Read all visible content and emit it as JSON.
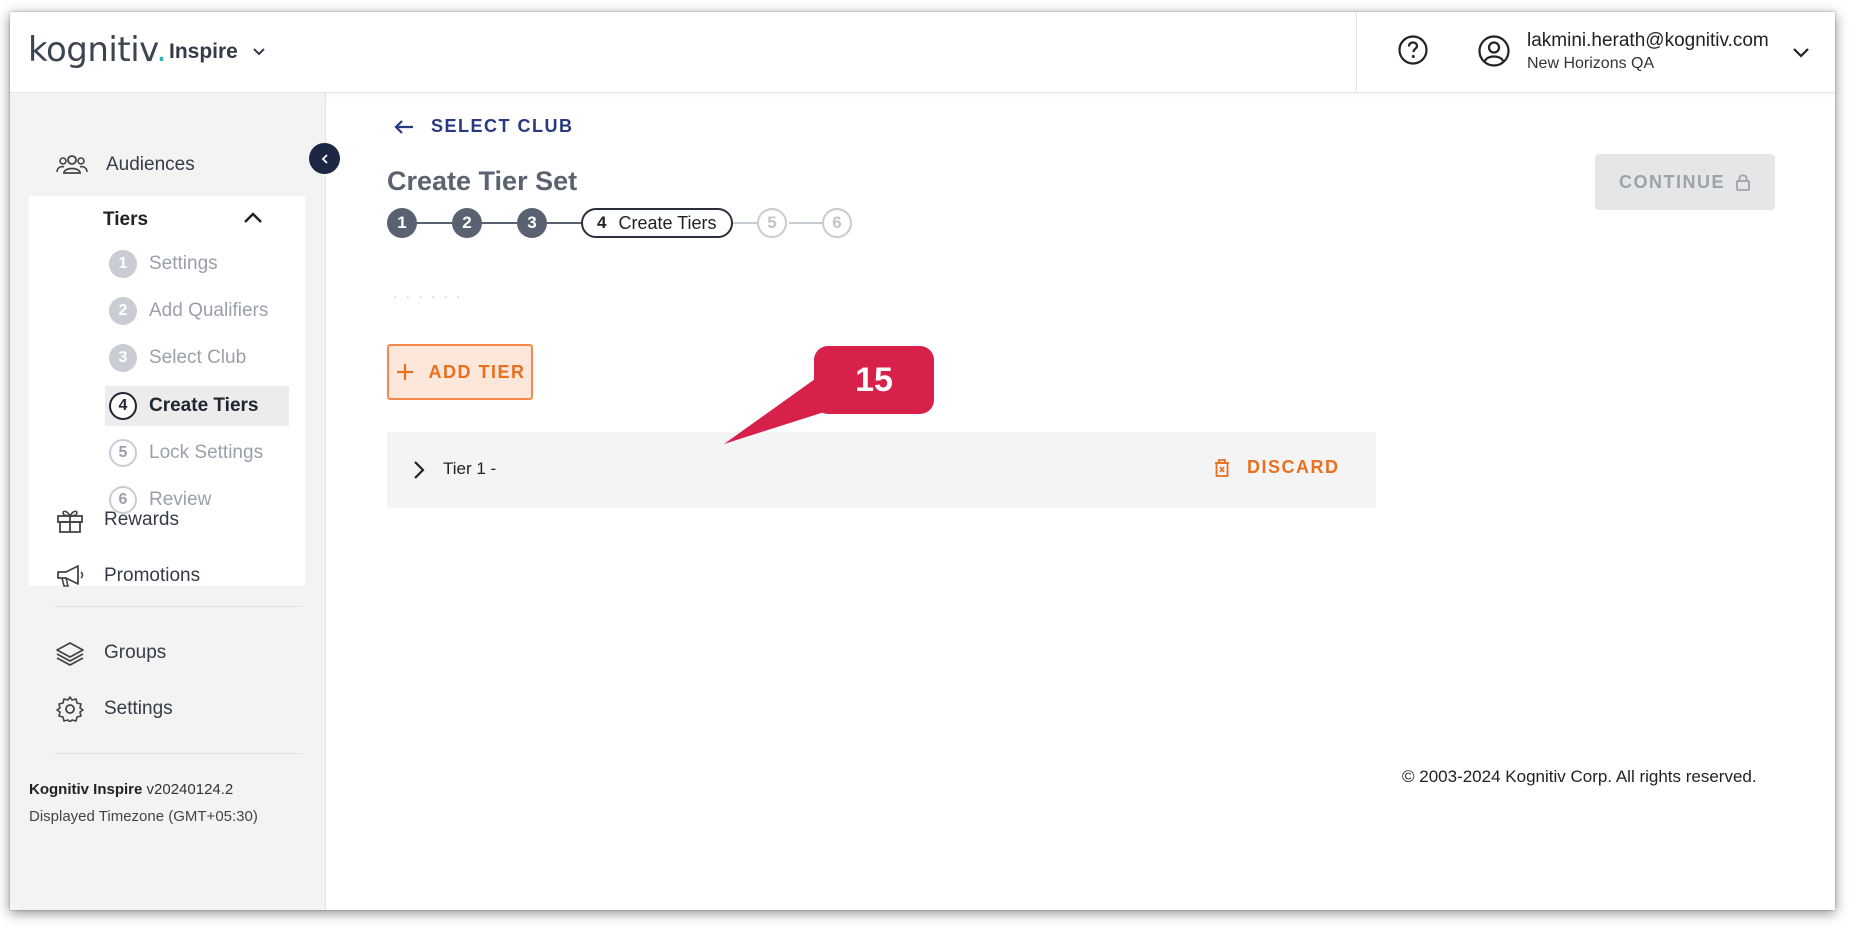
{
  "header": {
    "logo_text": "kognitiv",
    "logo_dot": ".",
    "app_name": "Inspire",
    "user_email": "lakmini.herath@kognitiv.com",
    "user_org": "New Horizons QA"
  },
  "sidebar": {
    "audiences": "Audiences",
    "tiers": {
      "title": "Tiers",
      "steps": [
        {
          "num": "1",
          "label": "Settings"
        },
        {
          "num": "2",
          "label": "Add Qualifiers"
        },
        {
          "num": "3",
          "label": "Select Club"
        },
        {
          "num": "4",
          "label": "Create Tiers"
        },
        {
          "num": "5",
          "label": "Lock Settings"
        },
        {
          "num": "6",
          "label": "Review"
        }
      ]
    },
    "rewards": "Rewards",
    "promotions": "Promotions",
    "groups": "Groups",
    "settings": "Settings",
    "version_product": "Kognitiv Inspire",
    "version_number": " v20240124.2",
    "timezone": "Displayed Timezone (GMT+05:30)"
  },
  "main": {
    "back_label": "SELECT CLUB",
    "title": "Create Tier Set",
    "stepper": {
      "done": [
        "1",
        "2",
        "3"
      ],
      "active_num": "4",
      "active_label": "Create Tiers",
      "future": [
        "5",
        "6"
      ]
    },
    "continue_label": "CONTINUE",
    "faded_text": "·  ·  ·  ·  ·  ·",
    "add_tier_label": "ADD TIER",
    "tier_row_label": "Tier 1 -",
    "discard_label": "DISCARD",
    "copyright": "© 2003-2024 Kognitiv Corp. All rights reserved."
  },
  "callout": {
    "number": "15"
  },
  "colors": {
    "accent_orange": "#e8701f",
    "navy": "#273a80",
    "callout_red": "#d7204a"
  }
}
